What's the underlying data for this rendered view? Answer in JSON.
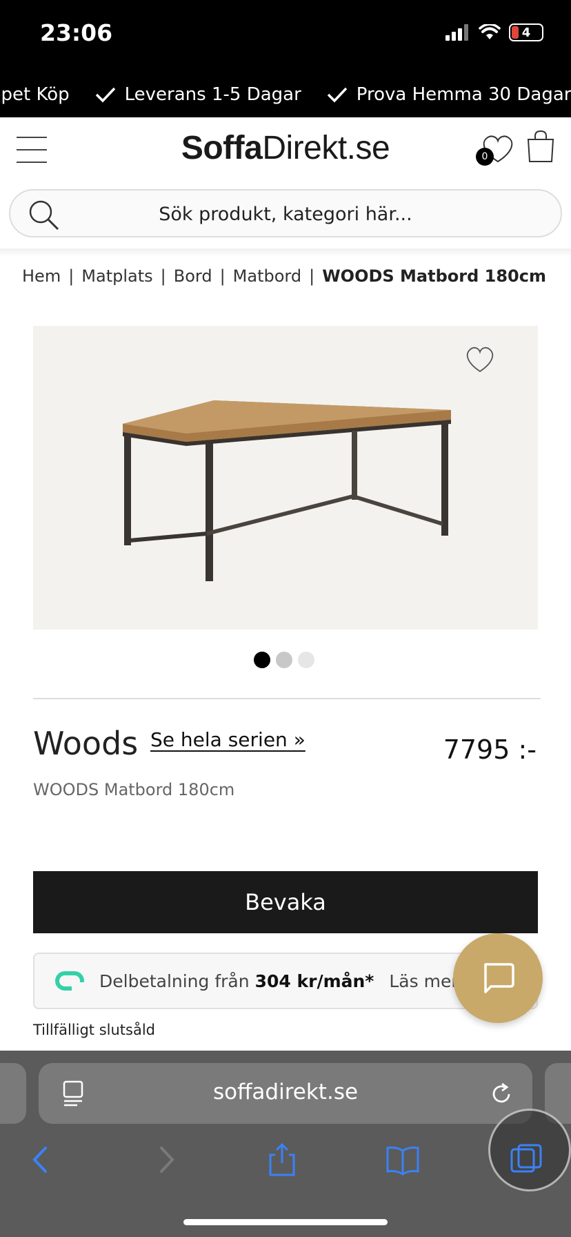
{
  "status_bar": {
    "time": "23:06",
    "battery": "4"
  },
  "usp": {
    "items": [
      "Öppet Köp",
      "Leverans 1-5 Dagar",
      "Prova Hemma 30 Dagar"
    ],
    "first_partial": "ppet Köp"
  },
  "header": {
    "logo_part1": "Soffa",
    "logo_part2": "Direkt.se",
    "wishlist_count": "0"
  },
  "search": {
    "placeholder": "Sök produkt, kategori här..."
  },
  "breadcrumb": {
    "items": [
      "Hem",
      "Matplats",
      "Bord",
      "Matbord"
    ],
    "separator": "|",
    "current": "WOODS Matbord 180cm"
  },
  "product": {
    "series": "Woods",
    "series_link": "Se hela serien »",
    "price": "7795 :-",
    "subtitle": "WOODS Matbord 180cm",
    "image_count": 3,
    "active_image": 0,
    "watch_label": "Bevaka",
    "installment_prefix": "Delbetalning från",
    "installment_amount": "304 kr/mån*",
    "installment_more": "Läs mer",
    "stock_status": "Tillfälligt slutsåld"
  },
  "browser": {
    "url": "soffadirekt.se"
  },
  "colors": {
    "accent_gold": "#c9a96a",
    "klarna_green": "#35d0a8",
    "ios_blue": "#3a82f7"
  }
}
